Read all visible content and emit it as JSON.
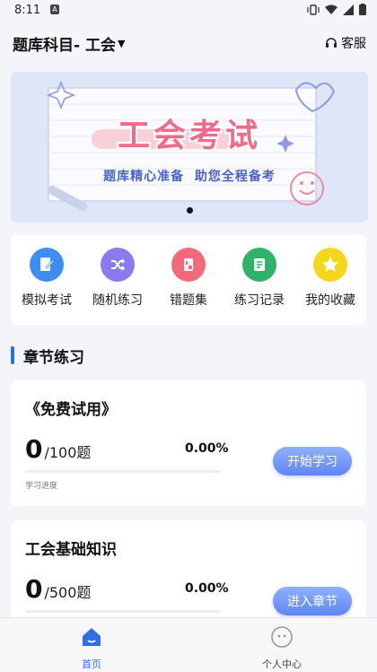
{
  "status_bar": {
    "time": "8:11",
    "badge": "A"
  },
  "header": {
    "subject": "题库科目- 工会",
    "service": "客服"
  },
  "banner": {
    "title": "工会考试",
    "subtitle": "题库精心准备  助您全程备考"
  },
  "menu": [
    {
      "label": "模拟考试",
      "color": "#3d8ef0",
      "icon": "exam-icon"
    },
    {
      "label": "随机练习",
      "color": "#8a7bf0",
      "icon": "shuffle-icon"
    },
    {
      "label": "错题集",
      "color": "#f06a7c",
      "icon": "wrong-questions-icon"
    },
    {
      "label": "练习记录",
      "color": "#2fb36a",
      "icon": "record-icon"
    },
    {
      "label": "我的收藏",
      "color": "#f4d71a",
      "icon": "star-icon"
    }
  ],
  "section": {
    "title": "章节练习"
  },
  "chapters": [
    {
      "title": "《免费试用》",
      "done": "0",
      "total": "/100题",
      "percent": "0.00%",
      "progress": 0,
      "caption": "学习进度",
      "button": "开始学习"
    },
    {
      "title": "工会基础知识",
      "done": "0",
      "total": "/500题",
      "percent": "0.00%",
      "progress": 0,
      "button": "进入章节"
    }
  ],
  "nav": [
    {
      "label": "首页",
      "active": true,
      "color": "#2f6fe0"
    },
    {
      "label": "个人中心",
      "active": false,
      "color": "#444"
    }
  ]
}
